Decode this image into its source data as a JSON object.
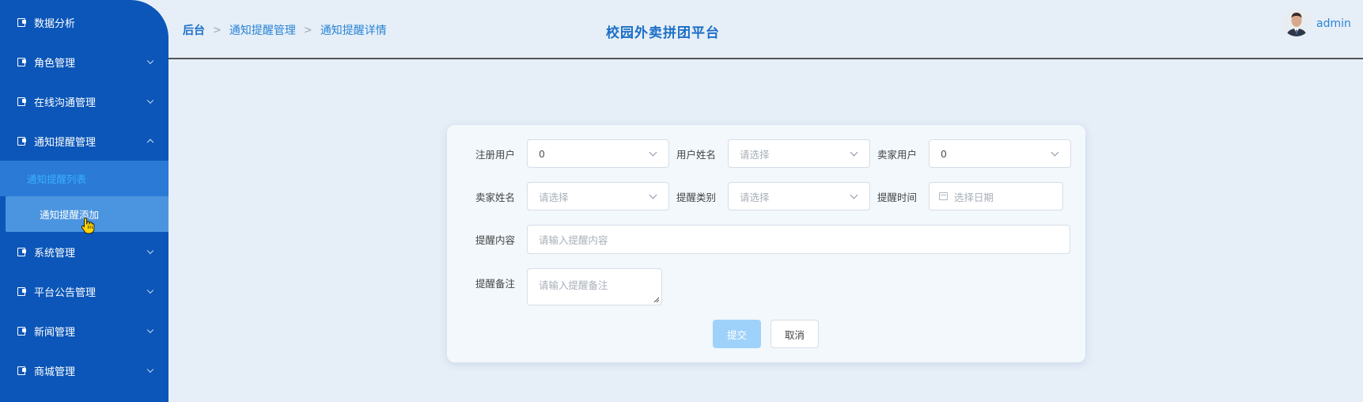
{
  "sidebar": {
    "items": [
      {
        "label": "数据分析",
        "icon": "menu-icon",
        "expandable": false
      },
      {
        "label": "角色管理",
        "icon": "menu-icon",
        "expandable": true
      },
      {
        "label": "在线沟通管理",
        "icon": "menu-icon",
        "expandable": true
      },
      {
        "label": "通知提醒管理",
        "icon": "menu-icon",
        "expandable": true,
        "expanded": true
      },
      {
        "label": "系统管理",
        "icon": "menu-icon",
        "expandable": true
      },
      {
        "label": "平台公告管理",
        "icon": "menu-icon",
        "expandable": true
      },
      {
        "label": "新闻管理",
        "icon": "menu-icon",
        "expandable": true
      },
      {
        "label": "商城管理",
        "icon": "menu-icon",
        "expandable": true
      }
    ],
    "subitems": [
      {
        "label": "通知提醒列表",
        "state": "active"
      },
      {
        "label": "通知提醒添加",
        "state": "hover"
      }
    ],
    "colors": {
      "bg": "#0b56b8",
      "active_text": "#3ab0ff"
    }
  },
  "header": {
    "breadcrumb": [
      "后台",
      "通知提醒管理",
      "通知提醒详情"
    ],
    "site_title": "校园外卖拼团平台",
    "user": "admin"
  },
  "form": {
    "registered_user": {
      "label": "注册用户",
      "value": "0"
    },
    "user_name": {
      "label": "用户姓名",
      "placeholder": "请选择"
    },
    "seller_user": {
      "label": "卖家用户",
      "value": "0"
    },
    "seller_name": {
      "label": "卖家姓名",
      "placeholder": "请选择"
    },
    "reminder_type": {
      "label": "提醒类别",
      "placeholder": "请选择"
    },
    "reminder_time": {
      "label": "提醒时间",
      "placeholder": "选择日期"
    },
    "reminder_content": {
      "label": "提醒内容",
      "placeholder": "请输入提醒内容"
    },
    "reminder_remark": {
      "label": "提醒备注",
      "placeholder": "请输入提醒备注"
    },
    "submit_label": "提交",
    "cancel_label": "取消"
  }
}
